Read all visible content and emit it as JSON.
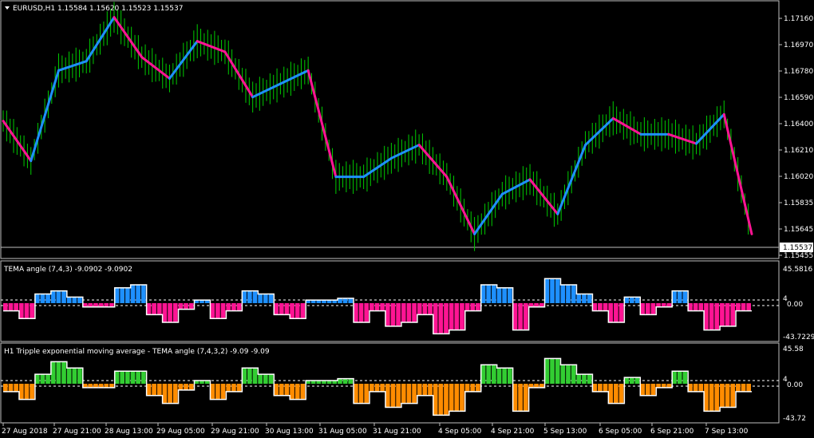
{
  "main": {
    "symbol_header": "EURUSD,H1  1.15584 1.15620 1.15523 1.15537",
    "menu_arrow_icon": "triangle-down",
    "current_price": "1.15537",
    "price_ticks": [
      "1.17160",
      "1.16970",
      "1.16780",
      "1.16590",
      "1.16400",
      "1.16210",
      "1.16020",
      "1.15835",
      "1.15645",
      "1.15455"
    ],
    "colors": {
      "up": "#1e90ff",
      "down": "#ff1493",
      "bars": "#00cc00"
    }
  },
  "ind1": {
    "header": "TEMA angle (7,4,3) -9.0902 -9.0902",
    "ticks": [
      "45.5816",
      "4",
      "0.00",
      "-43.7229"
    ],
    "colors": {
      "pos": "#1e90ff",
      "neg": "#ff1493",
      "line": "#ffffff"
    }
  },
  "ind2": {
    "header": "H1 Tripple exponential moving average - TEMA angle (7,4,3,2) -9.09 -9.09",
    "ticks": [
      "45.58",
      "4",
      "0.00",
      "-43.72"
    ],
    "colors": {
      "pos": "#32cd32",
      "neg": "#ff8c00",
      "line": "#ffffff"
    }
  },
  "time_axis": [
    "27 Aug 2018",
    "27 Aug 21:00",
    "28 Aug 13:00",
    "29 Aug 05:00",
    "29 Aug 21:00",
    "30 Aug 13:00",
    "31 Aug 05:00",
    "31 Aug 21:00",
    "4 Sep 05:00",
    "4 Sep 21:00",
    "5 Sep 13:00",
    "6 Sep 05:00",
    "6 Sep 21:00",
    "7 Sep 13:00"
  ],
  "chart_data": [
    {
      "type": "line",
      "title": "EURUSD,H1",
      "ylim": [
        1.1545,
        1.1725
      ],
      "x": [
        "27 Aug 2018",
        "27 Aug 21:00",
        "28 Aug 13:00",
        "29 Aug 05:00",
        "29 Aug 21:00",
        "30 Aug 13:00",
        "31 Aug 05:00",
        "31 Aug 21:00",
        "4 Sep 05:00",
        "4 Sep 21:00",
        "5 Sep 13:00",
        "6 Sep 05:00",
        "6 Sep 21:00",
        "7 Sep 13:00"
      ],
      "series": [
        {
          "name": "TEMA",
          "values": [
            1.164,
            1.161,
            1.1678,
            1.1685,
            1.1718,
            1.1688,
            1.1672,
            1.17,
            1.1692,
            1.1658,
            1.1668,
            1.1678,
            1.1598,
            1.1598,
            1.1612,
            1.1622,
            1.1598,
            1.1555,
            1.1585,
            1.1596,
            1.157,
            1.1622,
            1.1642,
            1.163,
            1.163,
            1.1623,
            1.1645,
            1.1555
          ]
        }
      ]
    },
    {
      "type": "bar",
      "title": "TEMA angle (7,4,3)",
      "ylim": [
        -43.7229,
        45.5816
      ],
      "values": [
        -10,
        -20,
        15,
        20,
        10,
        -5,
        -5,
        25,
        30,
        -15,
        -25,
        -8,
        5,
        -20,
        -10,
        20,
        15,
        -15,
        -20,
        5,
        5,
        8,
        -25,
        -10,
        -30,
        -25,
        -15,
        -40,
        -35,
        -10,
        30,
        25,
        -35,
        -5,
        40,
        30,
        15,
        -10,
        -25,
        10,
        -15,
        -5,
        20,
        -10,
        -35,
        -30,
        -10
      ]
    },
    {
      "type": "bar",
      "title": "H1 Tripple exponential moving average - TEMA angle (7,4,3,2)",
      "ylim": [
        -43.72,
        45.58
      ],
      "values": [
        -10,
        -20,
        15,
        35,
        25,
        -5,
        -5,
        20,
        20,
        -15,
        -25,
        -8,
        5,
        -20,
        -10,
        25,
        15,
        -15,
        -20,
        5,
        5,
        8,
        -25,
        -10,
        -30,
        -25,
        -15,
        -40,
        -35,
        -10,
        30,
        25,
        -35,
        -5,
        40,
        30,
        15,
        -10,
        -25,
        10,
        -15,
        -5,
        20,
        -10,
        -35,
        -30,
        -10
      ]
    }
  ]
}
